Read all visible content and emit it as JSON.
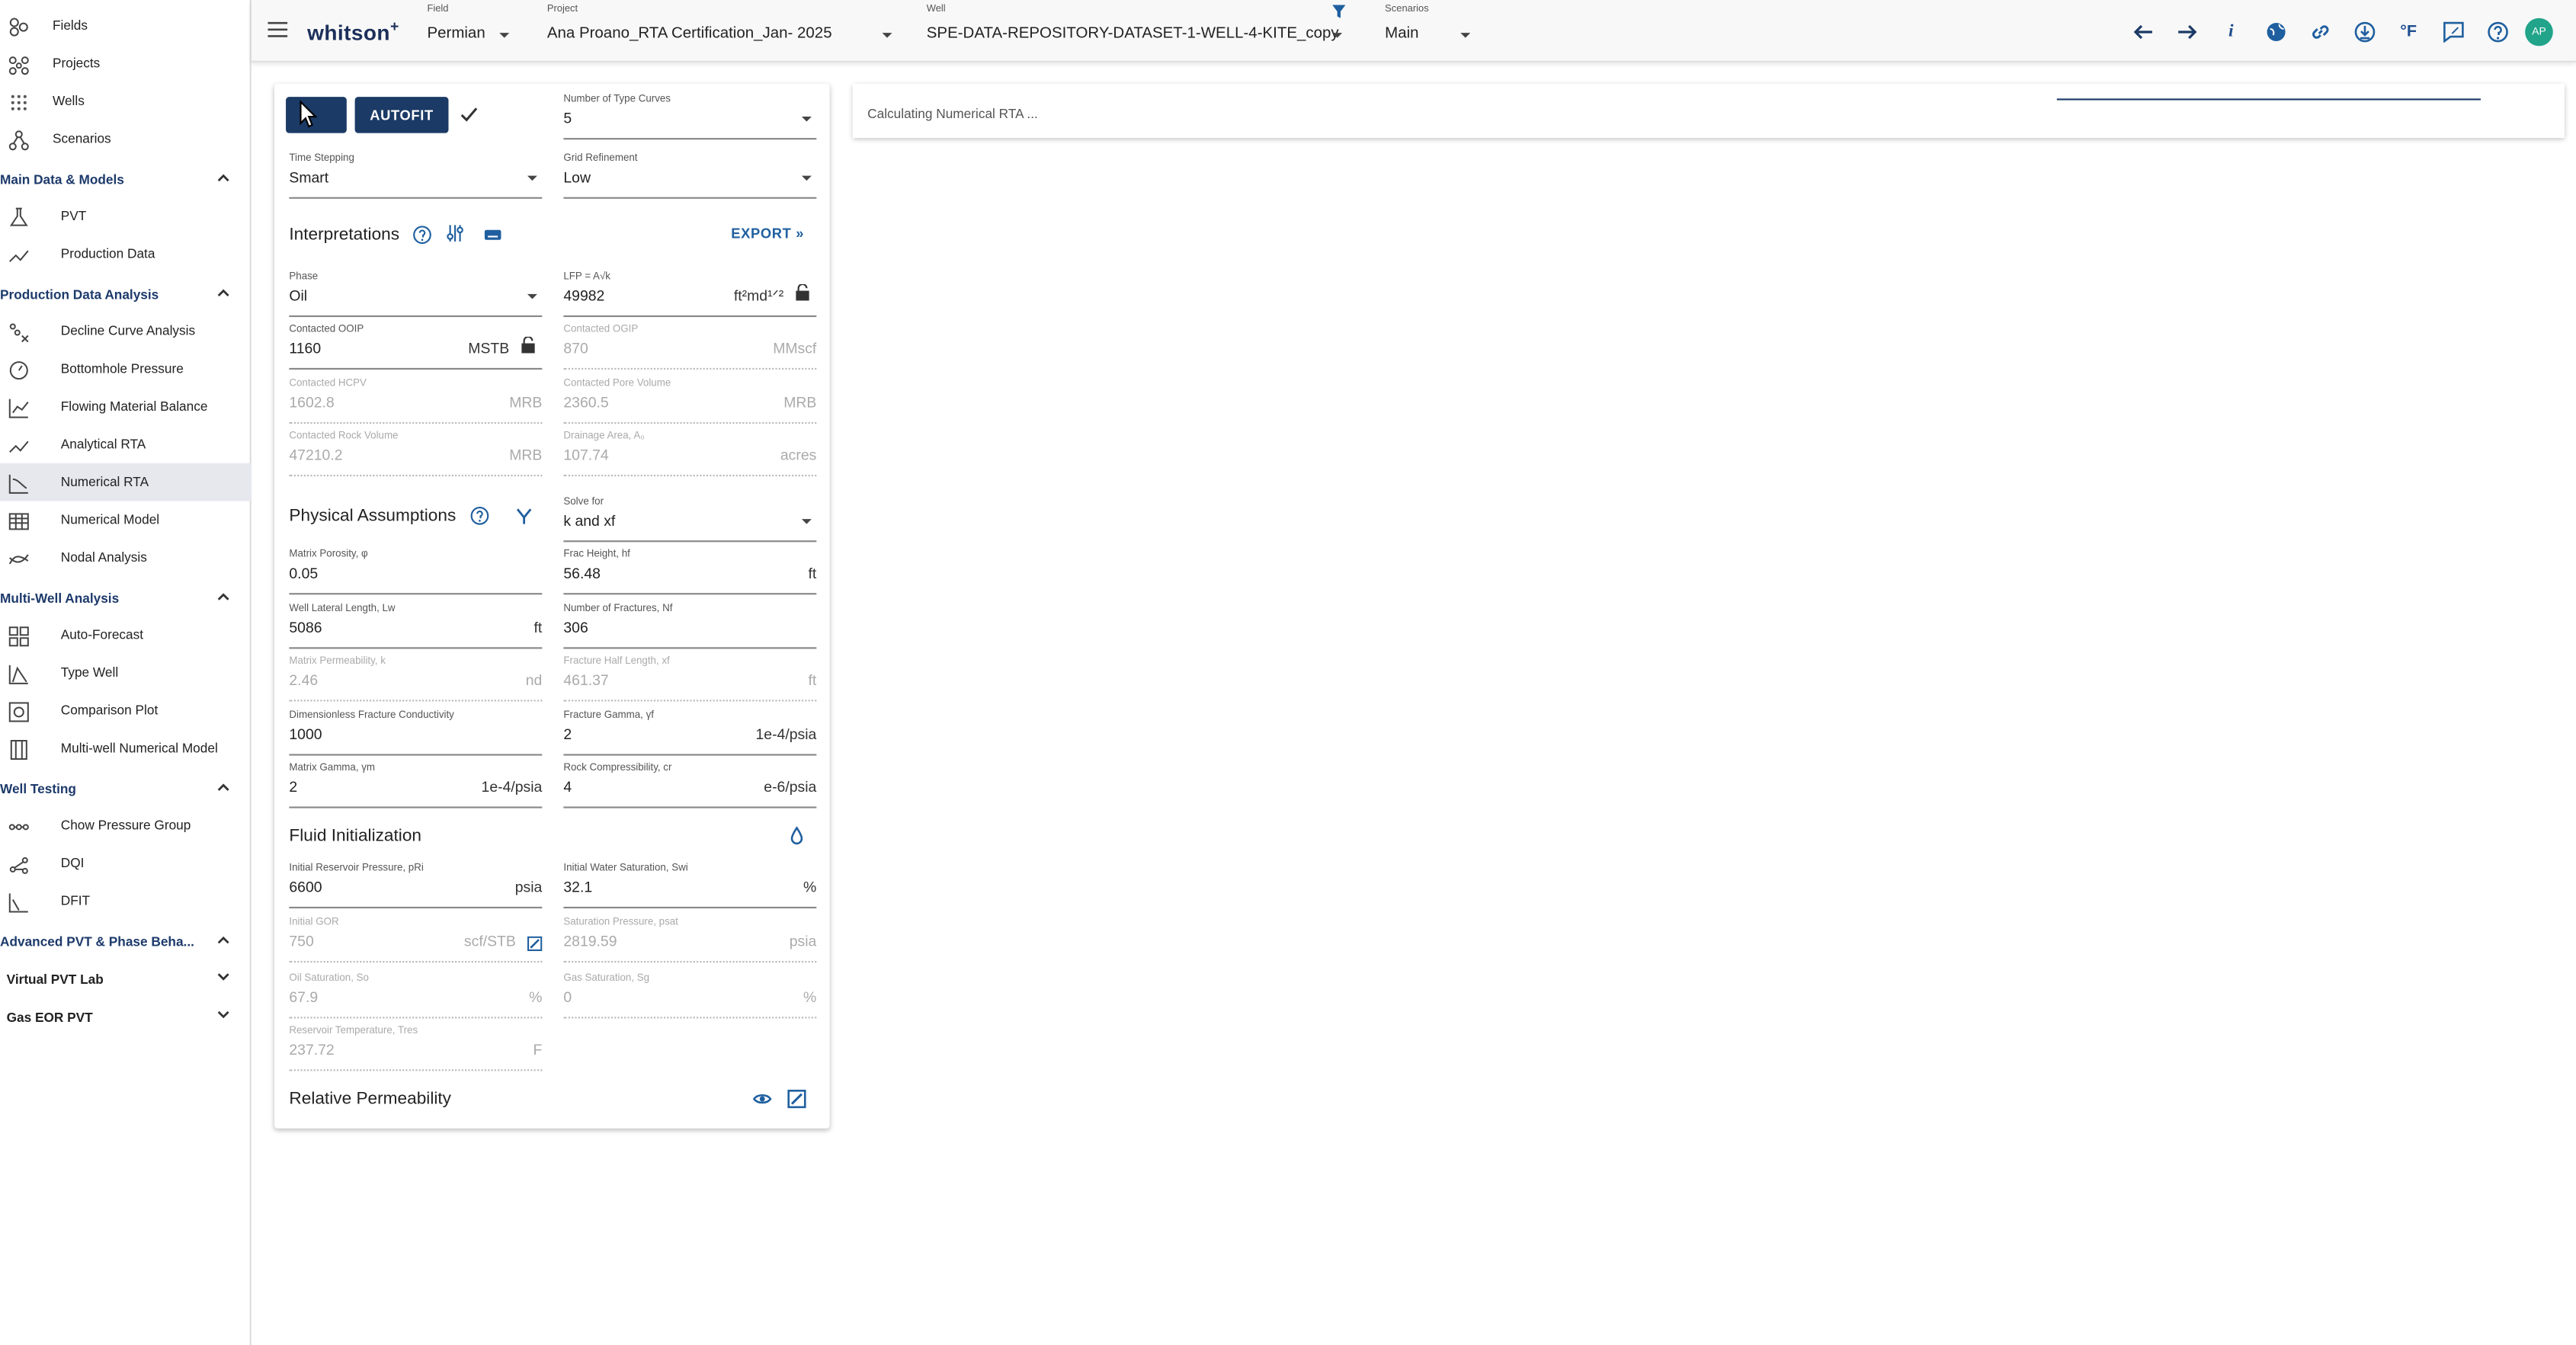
{
  "sidebar": {
    "top_items": [
      {
        "label": "Fields",
        "icon": "fields-icon"
      },
      {
        "label": "Projects",
        "icon": "projects-icon"
      },
      {
        "label": "Wells",
        "icon": "wells-icon"
      },
      {
        "label": "Scenarios",
        "icon": "scenarios-icon"
      }
    ],
    "sections": [
      {
        "title": "Main Data & Models",
        "items": [
          {
            "label": "PVT",
            "icon": "flask-icon"
          },
          {
            "label": "Production Data",
            "icon": "trend-icon"
          }
        ]
      },
      {
        "title": "Production Data Analysis",
        "items": [
          {
            "label": "Decline Curve Analysis",
            "icon": "decline-icon"
          },
          {
            "label": "Bottomhole Pressure",
            "icon": "gauge-icon"
          },
          {
            "label": "Flowing Material Balance",
            "icon": "chart-lines-icon"
          },
          {
            "label": "Analytical RTA",
            "icon": "trend-icon"
          },
          {
            "label": "Numerical RTA",
            "icon": "numerical-rta-icon"
          },
          {
            "label": "Numerical Model",
            "icon": "grid-building-icon"
          },
          {
            "label": "Nodal Analysis",
            "icon": "nodal-icon"
          }
        ]
      },
      {
        "title": "Multi-Well Analysis",
        "items": [
          {
            "label": "Auto-Forecast",
            "icon": "grid-icon"
          },
          {
            "label": "Type Well",
            "icon": "type-well-icon"
          },
          {
            "label": "Comparison Plot",
            "icon": "comparison-icon"
          },
          {
            "label": "Multi-well Numerical Model",
            "icon": "columns-icon"
          }
        ]
      },
      {
        "title": "Well Testing",
        "items": [
          {
            "label": "Chow Pressure Group",
            "icon": "chain-icon"
          },
          {
            "label": "DQI",
            "icon": "dqi-icon"
          },
          {
            "label": "DFIT",
            "icon": "dfit-icon"
          }
        ]
      }
    ],
    "collapsed_sections": [
      "Advanced PVT & Phase Beha...",
      "Virtual PVT Lab",
      "Gas EOR PVT"
    ],
    "active": "Numerical RTA"
  },
  "header": {
    "logo": "whitson",
    "logo_sup": "+",
    "field_caption": "Field",
    "field_value": "Permian",
    "project_caption": "Project",
    "project_value": "Ana Proano_RTA Certification_Jan- 2025",
    "well_caption": "Well",
    "well_value": "SPE-DATA-REPOSITORY-DATASET-1-WELL-4-KITE_copy",
    "scenario_caption": "Scenarios",
    "scenario_value": "Main",
    "temp_unit": "°F",
    "avatar": "AP"
  },
  "toolbar": {
    "autofit_label": "AUTOFIT"
  },
  "settings": {
    "type_curves_caption": "Number of Type Curves",
    "type_curves_value": "5",
    "time_stepping_caption": "Time Stepping",
    "time_stepping_value": "Smart",
    "grid_refinement_caption": "Grid Refinement",
    "grid_refinement_value": "Low"
  },
  "interpretations": {
    "title": "Interpretations",
    "export_label": "EXPORT",
    "phase_caption": "Phase",
    "phase_value": "Oil",
    "lfp_caption": "LFP = A√k",
    "lfp_value": "49982",
    "lfp_unit": "ft²md¹ᐟ²",
    "ooip_caption": "Contacted OOIP",
    "ooip_value": "1160",
    "ooip_unit": "MSTB",
    "ogip_caption": "Contacted OGIP",
    "ogip_value": "870",
    "ogip_unit": "MMscf",
    "hcpv_caption": "Contacted HCPV",
    "hcpv_value": "1602.8",
    "hcpv_unit": "MRB",
    "pore_caption": "Contacted Pore Volume",
    "pore_value": "2360.5",
    "pore_unit": "MRB",
    "rock_caption": "Contacted Rock Volume",
    "rock_value": "47210.2",
    "rock_unit": "MRB",
    "drainage_caption": "Drainage Area, A₀",
    "drainage_value": "107.74",
    "drainage_unit": "acres"
  },
  "physical": {
    "title": "Physical Assumptions",
    "solve_caption": "Solve for",
    "solve_value": "k and xf",
    "porosity_caption": "Matrix Porosity, φ",
    "porosity_value": "0.05",
    "frac_height_caption": "Frac Height, hf",
    "frac_height_value": "56.48",
    "frac_height_unit": "ft",
    "lateral_caption": "Well Lateral Length, Lw",
    "lateral_value": "5086",
    "lateral_unit": "ft",
    "nfrac_caption": "Number of Fractures, Nf",
    "nfrac_value": "306",
    "perm_caption": "Matrix Permeability, k",
    "perm_value": "2.46",
    "perm_unit": "nd",
    "xf_caption": "Fracture Half Length, xf",
    "xf_value": "461.37",
    "xf_unit": "ft",
    "fcd_caption": "Dimensionless Fracture Conductivity",
    "fcd_value": "1000",
    "fgamma_caption": "Fracture Gamma, γf",
    "fgamma_value": "2",
    "fgamma_unit": "1e-4/psia",
    "mgamma_caption": "Matrix Gamma, γm",
    "mgamma_value": "2",
    "mgamma_unit": "1e-4/psia",
    "rockc_caption": "Rock Compressibility, cr",
    "rockc_value": "4",
    "rockc_unit": "e-6/psia"
  },
  "fluid": {
    "title": "Fluid Initialization",
    "pres_caption": "Initial Reservoir Pressure, pRi",
    "pres_value": "6600",
    "pres_unit": "psia",
    "sw_caption": "Initial Water Saturation, Swi",
    "sw_value": "32.1",
    "sw_unit": "%",
    "gor_caption": "Initial GOR",
    "gor_value": "750",
    "gor_unit": "scf/STB",
    "psat_caption": "Saturation Pressure, psat",
    "psat_value": "2819.59",
    "psat_unit": "psia",
    "so_caption": "Oil Saturation, So",
    "so_value": "67.9",
    "so_unit": "%",
    "sg_caption": "Gas Saturation, Sg",
    "sg_value": "0",
    "sg_unit": "%",
    "temp_caption": "Reservoir Temperature, Tres",
    "temp_value": "237.72",
    "temp_unit": "F"
  },
  "relperm": {
    "title": "Relative Permeability"
  },
  "status": {
    "text": "Calculating Numerical RTA ..."
  },
  "colors": {
    "primary": "#1b3a66",
    "accent": "#1f5f9f",
    "avatar": "#21a48a"
  }
}
